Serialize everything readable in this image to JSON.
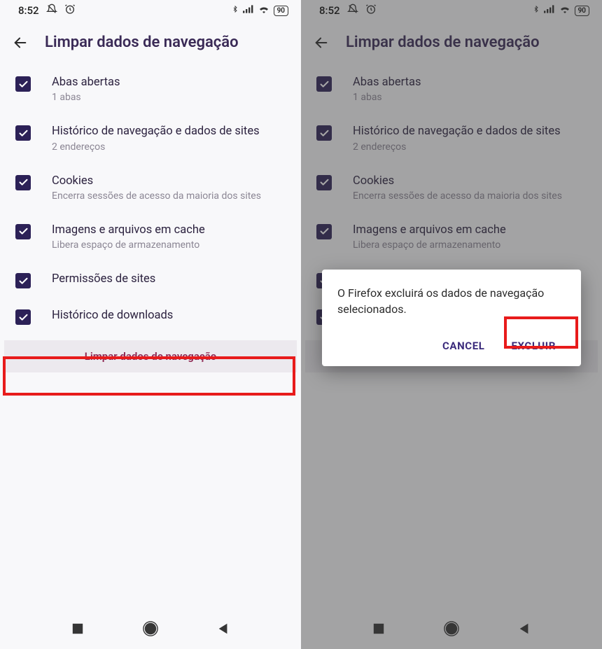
{
  "status": {
    "time": "8:52",
    "battery": "90"
  },
  "header": {
    "title": "Limpar dados de navegação"
  },
  "items": [
    {
      "label": "Abas abertas",
      "sub": "1 abas"
    },
    {
      "label": "Histórico de navegação e dados de sites",
      "sub": "2 endereços"
    },
    {
      "label": "Cookies",
      "sub": "Encerra sessões de acesso da maioria dos sites"
    },
    {
      "label": "Imagens e arquivos em cache",
      "sub": "Libera espaço de armazenamento"
    },
    {
      "label": "Permissões de sites",
      "sub": ""
    },
    {
      "label": "Histórico de downloads",
      "sub": ""
    }
  ],
  "clear_button": "Limpar dados de navegação",
  "dialog": {
    "message": "O Firefox excluirá os dados de navegação selecionados.",
    "cancel": "CANCEL",
    "confirm": "EXCLUIR"
  }
}
